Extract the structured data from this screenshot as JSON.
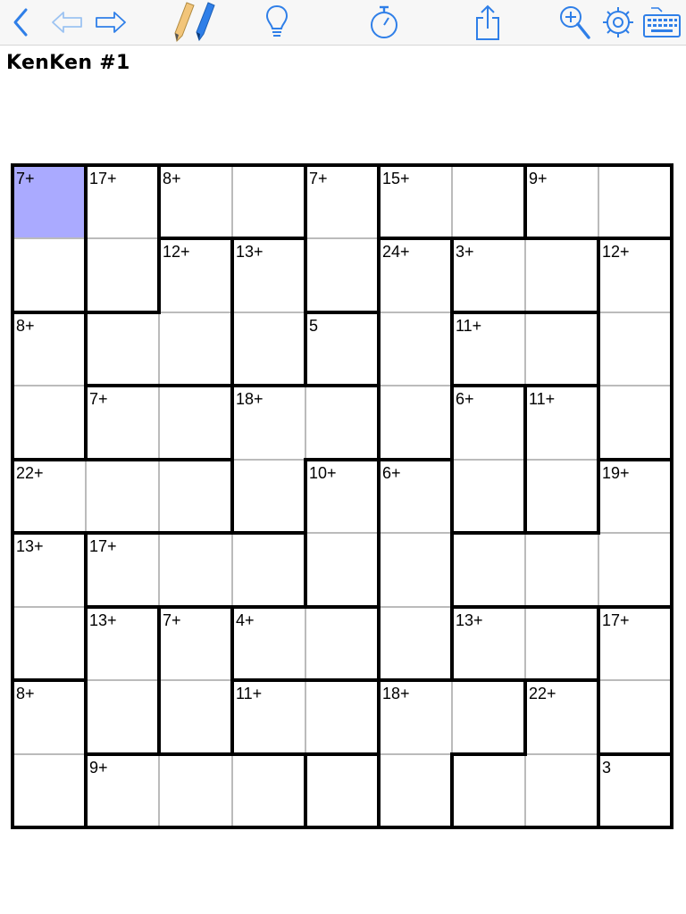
{
  "toolbar": {
    "accent": "#2f7fe8",
    "pencil_body": "#f2c57a",
    "buttons": [
      {
        "name": "back-button",
        "icon": "chevron-left-icon"
      },
      {
        "name": "undo-button",
        "icon": "arrow-left-icon"
      },
      {
        "name": "redo-button",
        "icon": "arrow-right-icon"
      },
      {
        "name": "pencil-mode-button",
        "icon": "pencil-icon"
      },
      {
        "name": "pen-mode-button",
        "icon": "pen-icon"
      },
      {
        "name": "hint-button",
        "icon": "lightbulb-icon"
      },
      {
        "name": "timer-button",
        "icon": "stopwatch-icon"
      },
      {
        "name": "share-button",
        "icon": "share-icon"
      },
      {
        "name": "zoom-button",
        "icon": "zoom-in-icon"
      },
      {
        "name": "settings-button",
        "icon": "gear-icon"
      },
      {
        "name": "keyboard-button",
        "icon": "keyboard-icon"
      }
    ]
  },
  "puzzle": {
    "title": "KenKen #1",
    "size": 9,
    "selected_cell": [
      0,
      0
    ],
    "selected_color": "#aaaaff",
    "cages": [
      {
        "clue": "7+",
        "cells": [
          [
            0,
            0
          ],
          [
            1,
            0
          ]
        ]
      },
      {
        "clue": "17+",
        "cells": [
          [
            0,
            1
          ],
          [
            1,
            1
          ],
          [
            1,
            2
          ]
        ]
      },
      {
        "clue": "8+",
        "cells": [
          [
            0,
            2
          ],
          [
            0,
            3
          ]
        ]
      },
      {
        "clue": "7+",
        "cells": [
          [
            0,
            4
          ],
          [
            1,
            4
          ]
        ]
      },
      {
        "clue": "15+",
        "cells": [
          [
            0,
            5
          ],
          [
            0,
            6
          ]
        ]
      },
      {
        "clue": "9+",
        "cells": [
          [
            0,
            7
          ],
          [
            0,
            8
          ]
        ]
      },
      {
        "clue": "12+",
        "cells": [
          [
            1,
            2
          ],
          [
            2,
            1
          ],
          [
            2,
            2
          ]
        ]
      },
      {
        "clue": "13+",
        "cells": [
          [
            1,
            3
          ],
          [
            2,
            3
          ],
          [
            3,
            3
          ]
        ]
      },
      {
        "clue": "24+",
        "cells": [
          [
            1,
            5
          ],
          [
            2,
            5
          ],
          [
            3,
            5
          ],
          [
            4,
            5
          ]
        ]
      },
      {
        "clue": "3+",
        "cells": [
          [
            1,
            6
          ],
          [
            1,
            7
          ]
        ]
      },
      {
        "clue": "12+",
        "cells": [
          [
            1,
            8
          ],
          [
            2,
            8
          ],
          [
            3,
            8
          ]
        ]
      },
      {
        "clue": "8+",
        "cells": [
          [
            2,
            0
          ],
          [
            3,
            0
          ]
        ]
      },
      {
        "clue": "5",
        "cells": [
          [
            2,
            4
          ]
        ]
      },
      {
        "clue": "11+",
        "cells": [
          [
            2,
            6
          ],
          [
            2,
            7
          ]
        ]
      },
      {
        "clue": "7+",
        "cells": [
          [
            3,
            1
          ],
          [
            3,
            2
          ]
        ]
      },
      {
        "clue": "18+",
        "cells": [
          [
            3,
            3
          ],
          [
            3,
            4
          ],
          [
            4,
            3
          ]
        ]
      },
      {
        "clue": "6+",
        "cells": [
          [
            3,
            6
          ],
          [
            4,
            6
          ]
        ]
      },
      {
        "clue": "11+",
        "cells": [
          [
            3,
            7
          ],
          [
            4,
            7
          ]
        ]
      },
      {
        "clue": "22+",
        "cells": [
          [
            4,
            0
          ],
          [
            4,
            1
          ],
          [
            4,
            2
          ]
        ]
      },
      {
        "clue": "10+",
        "cells": [
          [
            4,
            4
          ],
          [
            5,
            4
          ]
        ]
      },
      {
        "clue": "6+",
        "cells": [
          [
            4,
            5
          ],
          [
            5,
            5
          ],
          [
            6,
            5
          ]
        ]
      },
      {
        "clue": "19+",
        "cells": [
          [
            4,
            8
          ],
          [
            5,
            8
          ],
          [
            5,
            6
          ],
          [
            5,
            7
          ]
        ]
      },
      {
        "clue": "13+",
        "cells": [
          [
            5,
            0
          ],
          [
            6,
            0
          ]
        ]
      },
      {
        "clue": "17+",
        "cells": [
          [
            5,
            1
          ],
          [
            5,
            2
          ],
          [
            5,
            3
          ]
        ]
      },
      {
        "clue": "13+",
        "cells": [
          [
            6,
            1
          ],
          [
            7,
            1
          ]
        ]
      },
      {
        "clue": "7+",
        "cells": [
          [
            6,
            2
          ],
          [
            7,
            2
          ]
        ]
      },
      {
        "clue": "4+",
        "cells": [
          [
            6,
            3
          ],
          [
            6,
            4
          ]
        ]
      },
      {
        "clue": "13+",
        "cells": [
          [
            6,
            6
          ],
          [
            6,
            7
          ]
        ]
      },
      {
        "clue": "17+",
        "cells": [
          [
            6,
            8
          ],
          [
            7,
            8
          ]
        ]
      },
      {
        "clue": "8+",
        "cells": [
          [
            7,
            0
          ],
          [
            8,
            0
          ]
        ]
      },
      {
        "clue": "11+",
        "cells": [
          [
            7,
            3
          ],
          [
            7,
            4
          ]
        ]
      },
      {
        "clue": "18+",
        "cells": [
          [
            7,
            5
          ],
          [
            7,
            6
          ],
          [
            8,
            5
          ]
        ]
      },
      {
        "clue": "22+",
        "cells": [
          [
            7,
            7
          ],
          [
            8,
            6
          ],
          [
            8,
            7
          ]
        ]
      },
      {
        "clue": "9+",
        "cells": [
          [
            8,
            1
          ],
          [
            8,
            2
          ],
          [
            8,
            3
          ]
        ]
      },
      {
        "clue": "",
        "cells": [
          [
            8,
            4
          ]
        ]
      },
      {
        "clue": "3",
        "cells": [
          [
            8,
            8
          ]
        ]
      }
    ]
  }
}
